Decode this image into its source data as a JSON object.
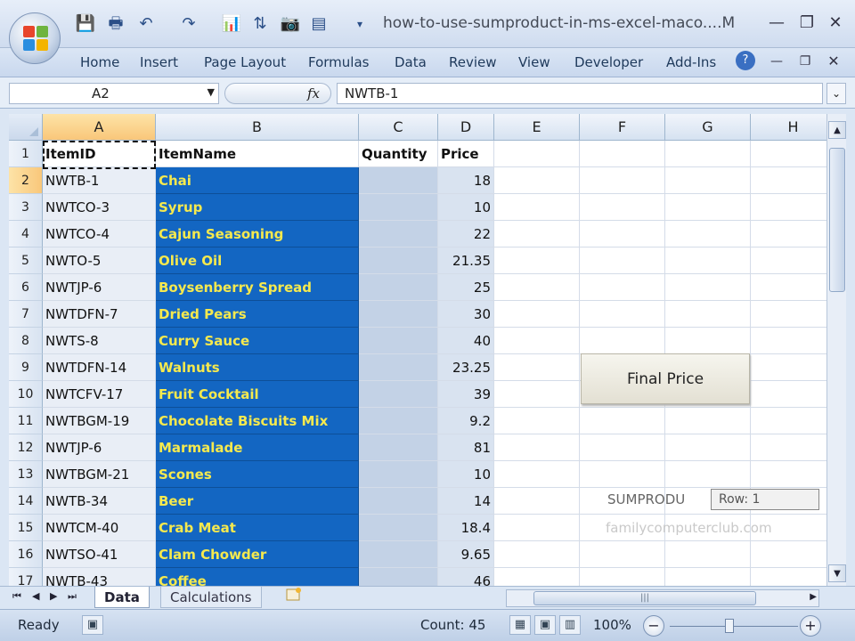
{
  "window": {
    "title": "how-to-use-sumproduct-in-ms-excel-maco....M",
    "minimize_glyph": "—",
    "restore_glyph": "❐",
    "close_glyph": "✕",
    "doc_minimize_glyph": "—",
    "doc_restore_glyph": "❐",
    "doc_close_glyph": "✕",
    "qa_overflow_glyph": "▾",
    "help_glyph": "?"
  },
  "quick_access": {
    "save_glyph": "💾",
    "print_glyph": "🖶",
    "undo_glyph": "↶",
    "redo_glyph": "↷",
    "chart_glyph": "📊",
    "sort_glyph": "⇅",
    "camera_glyph": "📷",
    "form_glyph": "▤"
  },
  "ribbon_tabs": [
    "Home",
    "Insert",
    "Page Layout",
    "Formulas",
    "Data",
    "Review",
    "View",
    "Developer",
    "Add-Ins"
  ],
  "formula_bar": {
    "name_box": "A2",
    "fx_label": "fx",
    "formula": "NWTB-1",
    "dropdown_glyph": "▼",
    "expand_glyph": "⌄"
  },
  "columns": [
    "A",
    "B",
    "C",
    "D",
    "E",
    "F",
    "G",
    "H"
  ],
  "row_numbers": [
    "1",
    "2",
    "3",
    "4",
    "5",
    "6",
    "7",
    "8",
    "9",
    "10",
    "11",
    "12",
    "13",
    "14",
    "15",
    "16",
    "17"
  ],
  "header_row": {
    "item_id": "ItemID",
    "item_name": "ItemName",
    "quantity": "Quantity",
    "price": "Price"
  },
  "rows": [
    {
      "id": "NWTB-1",
      "name": "Chai",
      "qty": "",
      "price": "18"
    },
    {
      "id": "NWTCO-3",
      "name": "Syrup",
      "qty": "",
      "price": "10"
    },
    {
      "id": "NWTCO-4",
      "name": "Cajun Seasoning",
      "qty": "",
      "price": "22"
    },
    {
      "id": "NWTO-5",
      "name": "Olive Oil",
      "qty": "",
      "price": "21.35"
    },
    {
      "id": "NWTJP-6",
      "name": "Boysenberry Spread",
      "qty": "",
      "price": "25"
    },
    {
      "id": "NWTDFN-7",
      "name": "Dried Pears",
      "qty": "",
      "price": "30"
    },
    {
      "id": "NWTS-8",
      "name": "Curry Sauce",
      "qty": "",
      "price": "40"
    },
    {
      "id": "NWTDFN-14",
      "name": "Walnuts",
      "qty": "",
      "price": "23.25"
    },
    {
      "id": "NWTCFV-17",
      "name": "Fruit Cocktail",
      "qty": "",
      "price": "39"
    },
    {
      "id": "NWTBGM-19",
      "name": "Chocolate Biscuits Mix",
      "qty": "",
      "price": "9.2"
    },
    {
      "id": "NWTJP-6",
      "name": "Marmalade",
      "qty": "",
      "price": "81"
    },
    {
      "id": "NWTBGM-21",
      "name": "Scones",
      "qty": "",
      "price": "10"
    },
    {
      "id": "NWTB-34",
      "name": "Beer",
      "qty": "",
      "price": "14"
    },
    {
      "id": "NWTCM-40",
      "name": "Crab Meat",
      "qty": "",
      "price": "18.4"
    },
    {
      "id": "NWTSO-41",
      "name": "Clam Chowder",
      "qty": "",
      "price": "9.65"
    },
    {
      "id": "NWTB-43",
      "name": "Coffee",
      "qty": "",
      "price": "46"
    }
  ],
  "final_price_button": "Final Price",
  "sumproduct_label": "SUMPRODU",
  "row_tooltip": "Row: 1",
  "watermark": "familycomputerclub.com",
  "sheet_tabs": [
    "Data",
    "Calculations"
  ],
  "sheet_nav": [
    "⏮",
    "◀",
    "▶",
    "⏭"
  ],
  "scroll": {
    "up": "▲",
    "down": "▼",
    "left": "◀",
    "right": "▶",
    "grip": "|||"
  },
  "status": {
    "ready": "Ready",
    "count": "Count: 45",
    "zoom": "100%",
    "zoom_out_glyph": "−",
    "zoom_in_glyph": "+",
    "view_normal_glyph": "▦",
    "view_layout_glyph": "▣",
    "view_break_glyph": "▥",
    "macro_glyph": "▣"
  },
  "colors": {
    "name_fill": "#1366c2",
    "name_text": "#f5e94e",
    "selected_header": "#f9c77a"
  }
}
